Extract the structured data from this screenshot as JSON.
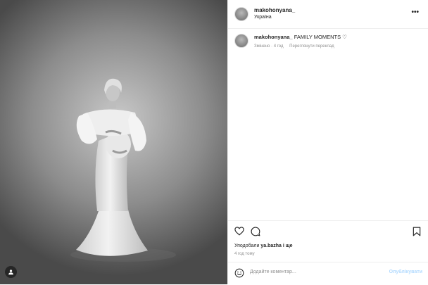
{
  "post": {
    "username": "makohonyana_",
    "location": "Україна",
    "more_icon": "•••"
  },
  "caption": {
    "username": "makohonyana_",
    "text": "FAMILY MOMENTS ♡",
    "edited": "Змінено · 4 год",
    "translate_label": "Переглянути переклад"
  },
  "actions": {
    "liked_by_prefix": "Уподобали",
    "liked_by_user": "ya.bazha",
    "liked_by_suffix": "і ще",
    "time_ago": "4 год тому"
  },
  "comment": {
    "placeholder": "Додайте коментар...",
    "publish_label": "Опублікувати"
  },
  "colors": {
    "accent_disabled": "#b3dbff",
    "border": "#efefef",
    "text": "#262626",
    "muted": "#8e8e8e"
  },
  "icons": [
    "more-icon",
    "heart-icon",
    "comment-icon",
    "bookmark-icon",
    "emoji-icon",
    "user-tag-icon"
  ]
}
